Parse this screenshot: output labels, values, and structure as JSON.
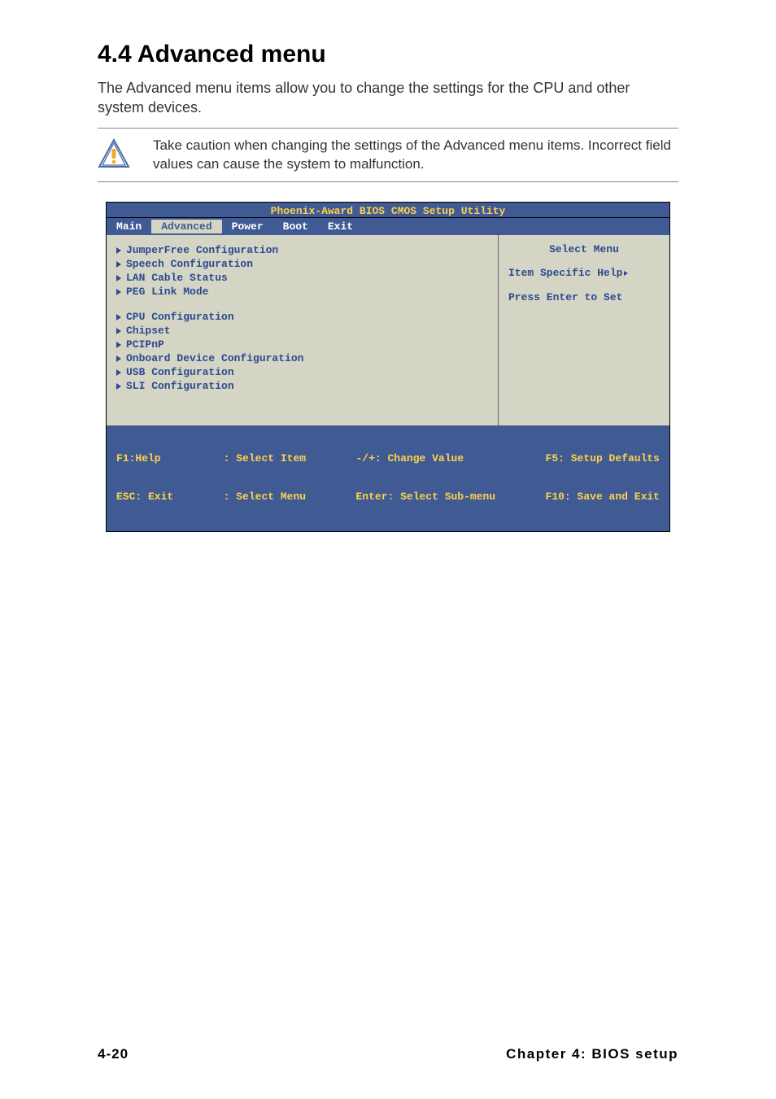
{
  "heading": "4.4    Advanced menu",
  "intro": "The Advanced menu items allow you to change the settings for the CPU and other system devices.",
  "warning": "Take caution when changing the settings of the Advanced menu items. Incorrect field values can cause the system to malfunction.",
  "bios": {
    "title": "Phoenix-Award BIOS CMOS Setup Utility",
    "tabs": [
      "Main",
      "Advanced",
      "Power",
      "Boot",
      "Exit"
    ],
    "active_tab": "Advanced",
    "group1": [
      "JumperFree Configuration",
      "Speech Configuration",
      "LAN Cable Status",
      "PEG Link Mode"
    ],
    "group2": [
      "CPU Configuration",
      "Chipset",
      "PCIPnP",
      "Onboard Device Configuration",
      "USB Configuration",
      "SLI Configuration"
    ],
    "help_panel": {
      "title": "Select Menu",
      "line1": "Item Specific Help",
      "line2": "Press Enter to Set"
    },
    "footer": {
      "c1a": "F1:Help",
      "c1b": "ESC: Exit",
      "c2a": ": Select Item",
      "c2b": ": Select Menu",
      "c3a": "-/+: Change Value",
      "c3b": "Enter: Select Sub-menu",
      "c4a": "F5: Setup Defaults",
      "c4b": "F10: Save and Exit"
    }
  },
  "page_footer": {
    "left": "4-20",
    "right": "Chapter 4: BIOS setup"
  }
}
